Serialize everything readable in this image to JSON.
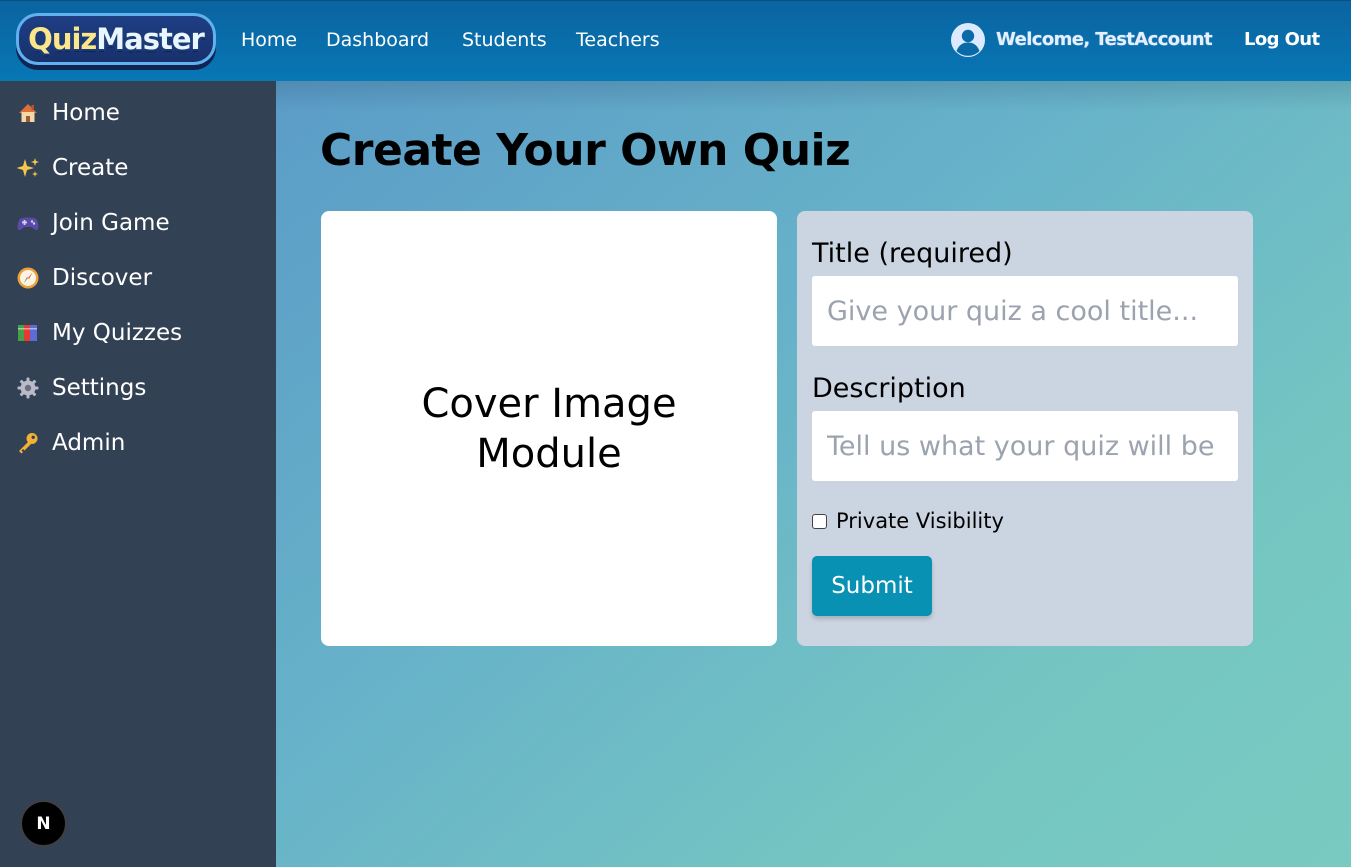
{
  "header": {
    "logo": {
      "part1": "Quiz",
      "part2": "Master"
    },
    "nav": [
      "Home",
      "Dashboard",
      "Students",
      "Teachers"
    ],
    "welcome": "Welcome, TestAccount",
    "logout": "Log Out"
  },
  "sidebar": {
    "items": [
      {
        "label": "Home",
        "icon": "house-icon"
      },
      {
        "label": "Create",
        "icon": "sparkles-icon"
      },
      {
        "label": "Join Game",
        "icon": "gamepad-icon"
      },
      {
        "label": "Discover",
        "icon": "compass-icon"
      },
      {
        "label": "My Quizzes",
        "icon": "books-icon"
      },
      {
        "label": "Settings",
        "icon": "gear-icon"
      },
      {
        "label": "Admin",
        "icon": "key-icon"
      }
    ],
    "badge": "N"
  },
  "main": {
    "title": "Create Your Own Quiz",
    "cover": "Cover Image Module",
    "form": {
      "title_label": "Title (required)",
      "title_placeholder": "Give your quiz a cool title...",
      "description_label": "Description",
      "description_placeholder": "Tell us what your quiz will be about...",
      "private_label": "Private Visibility",
      "private_checked": false,
      "submit_label": "Submit"
    }
  },
  "colors": {
    "topbar": "#0877b5",
    "sidebar": "#334155",
    "form_card": "#cbd5e1",
    "submit": "#0891b2"
  }
}
